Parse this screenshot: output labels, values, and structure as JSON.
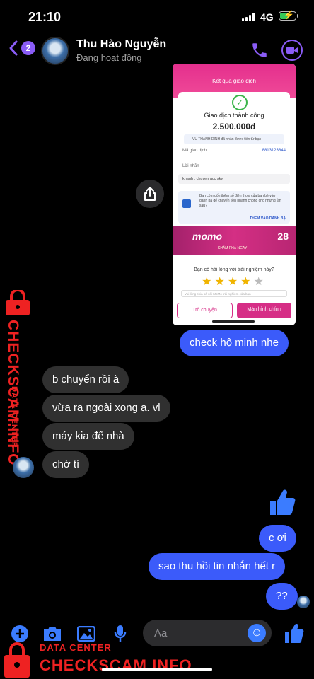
{
  "status_bar": {
    "time": "21:10",
    "network": "4G"
  },
  "header": {
    "back_badge": "2",
    "contact_name": "Thu Hào Nguyễn",
    "contact_status": "Đang hoạt động"
  },
  "shared_image": {
    "title": "Kết quả giao dịch",
    "success_text": "Giao dịch thành công",
    "amount": "2.500.000đ",
    "note": "VU THANH DINH đã nhận được tiền từ bạn",
    "txn_label": "Mã giao dịch",
    "txn_value": "8813123844",
    "message_label": "Lời nhắn",
    "message_value": "khanh , chuyen acc sky",
    "contact_prompt": "Bạn có muốn thêm số điện thoại của bạn bè vào danh bạ để chuyển tiền nhanh chóng cho những lần sau?",
    "contact_link": "THÊM VÀO DANH BẠ",
    "banner_text": "momo",
    "banner_cta": "KHÁM PHÁ NGAY",
    "banner_date": "28",
    "rating_prompt": "Bạn có hài lòng với trải nghiệm này?",
    "rating": 4,
    "rating_max": 5,
    "feedback_placeholder": "Vui lòng chia sẻ với MoMo trải nghiệm của bạn",
    "btn_chat": "Trò chuyện",
    "btn_home": "Màn hình chính"
  },
  "messages": [
    {
      "dir": "out",
      "text": "check hộ minh nhe"
    },
    {
      "dir": "in",
      "text": "b chuyển rồi à"
    },
    {
      "dir": "in",
      "text": "vừa ra ngoài xong ạ. vl"
    },
    {
      "dir": "in",
      "text": "máy kia để nhà"
    },
    {
      "dir": "in",
      "text": "chờ tí"
    },
    {
      "dir": "out",
      "text": "c ơi"
    },
    {
      "dir": "out",
      "text": "sao thu hồi tin nhắn hết r"
    },
    {
      "dir": "out",
      "text": "??"
    }
  ],
  "composer": {
    "placeholder": "Aa"
  },
  "watermark": {
    "side_small": "DATA CENTER",
    "side_big": "CHECKSCAM.INFO",
    "bottom_small": "DATA CENTER",
    "bottom_big": "CHECKSCAM.INFO"
  },
  "colors": {
    "accent": "#8a5cf6",
    "outgoing_bubble": "#3b5bfa",
    "incoming_bubble": "#303030",
    "watermark": "#e22222",
    "momo": "#d62e86"
  },
  "icons": {
    "back": "chevron-left-icon",
    "call": "phone-icon",
    "video": "video-icon",
    "share": "share-icon",
    "composer": [
      "plus-icon",
      "camera-icon",
      "image-icon",
      "microphone-icon"
    ],
    "emoji": "emoji-icon",
    "like": "thumbs-up-icon"
  }
}
